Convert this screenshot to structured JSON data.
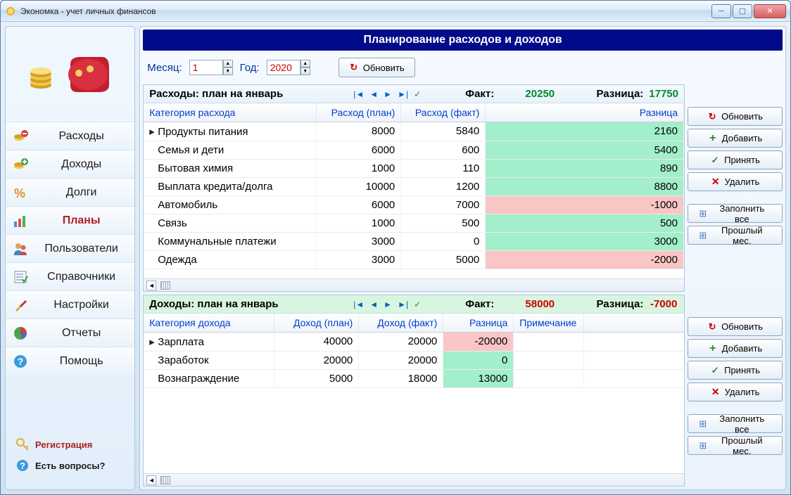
{
  "window": {
    "title": "Экономка - учет личных финансов"
  },
  "sidebar": {
    "items": [
      {
        "label": "Расходы",
        "icon": "coins-minus-icon"
      },
      {
        "label": "Доходы",
        "icon": "coins-plus-icon"
      },
      {
        "label": "Долги",
        "icon": "percent-icon"
      },
      {
        "label": "Планы",
        "icon": "chart-icon",
        "active": true
      },
      {
        "label": "Пользователи",
        "icon": "users-icon"
      },
      {
        "label": "Справочники",
        "icon": "list-check-icon"
      },
      {
        "label": "Настройки",
        "icon": "tools-icon"
      },
      {
        "label": "Отчеты",
        "icon": "pie-icon"
      },
      {
        "label": "Помощь",
        "icon": "help-icon"
      }
    ],
    "register": "Регистрация",
    "questions": "Есть вопросы?"
  },
  "page": {
    "title": "Планирование расходов и доходов",
    "month_label": "Месяц:",
    "month_value": "1",
    "year_label": "Год:",
    "year_value": "2020",
    "refresh": "Обновить"
  },
  "expenses": {
    "title": "Расходы: план на январь",
    "fact_label": "Факт:",
    "fact_value": "20250",
    "diff_label": "Разница:",
    "diff_value": "17750",
    "cols": {
      "cat": "Категория расхода",
      "plan": "Расход (план)",
      "fact": "Расход (факт)",
      "diff": "Разница"
    },
    "rows": [
      {
        "cat": "Продукты питания",
        "plan": "8000",
        "fact": "5840",
        "diff": "2160",
        "pos": true,
        "ptr": true
      },
      {
        "cat": "Семья и дети",
        "plan": "6000",
        "fact": "600",
        "diff": "5400",
        "pos": true
      },
      {
        "cat": "Бытовая химия",
        "plan": "1000",
        "fact": "110",
        "diff": "890",
        "pos": true
      },
      {
        "cat": "Выплата кредита/долга",
        "plan": "10000",
        "fact": "1200",
        "diff": "8800",
        "pos": true
      },
      {
        "cat": "Автомобиль",
        "plan": "6000",
        "fact": "7000",
        "diff": "-1000",
        "pos": false
      },
      {
        "cat": "Связь",
        "plan": "1000",
        "fact": "500",
        "diff": "500",
        "pos": true
      },
      {
        "cat": "Коммунальные платежи",
        "plan": "3000",
        "fact": "0",
        "diff": "3000",
        "pos": true
      },
      {
        "cat": "Одежда",
        "plan": "3000",
        "fact": "5000",
        "diff": "-2000",
        "pos": false
      }
    ]
  },
  "incomes": {
    "title": "Доходы: план на январь",
    "fact_label": "Факт:",
    "fact_value": "58000",
    "diff_label": "Разница:",
    "diff_value": "-7000",
    "cols": {
      "cat": "Категория дохода",
      "plan": "Доход (план)",
      "fact": "Доход (факт)",
      "diff": "Разница",
      "note": "Примечание"
    },
    "rows": [
      {
        "cat": "Зарплата",
        "plan": "40000",
        "fact": "20000",
        "diff": "-20000",
        "pos": false,
        "ptr": true
      },
      {
        "cat": "Заработок",
        "plan": "20000",
        "fact": "20000",
        "diff": "0",
        "pos": true
      },
      {
        "cat": "Вознаграждение",
        "plan": "5000",
        "fact": "18000",
        "diff": "13000",
        "pos": true
      }
    ]
  },
  "actions": {
    "refresh": "Обновить",
    "add": "Добавить",
    "accept": "Принять",
    "delete": "Удалить",
    "fillall": "Заполнить все",
    "lastmonth": "Прошлый мес."
  }
}
